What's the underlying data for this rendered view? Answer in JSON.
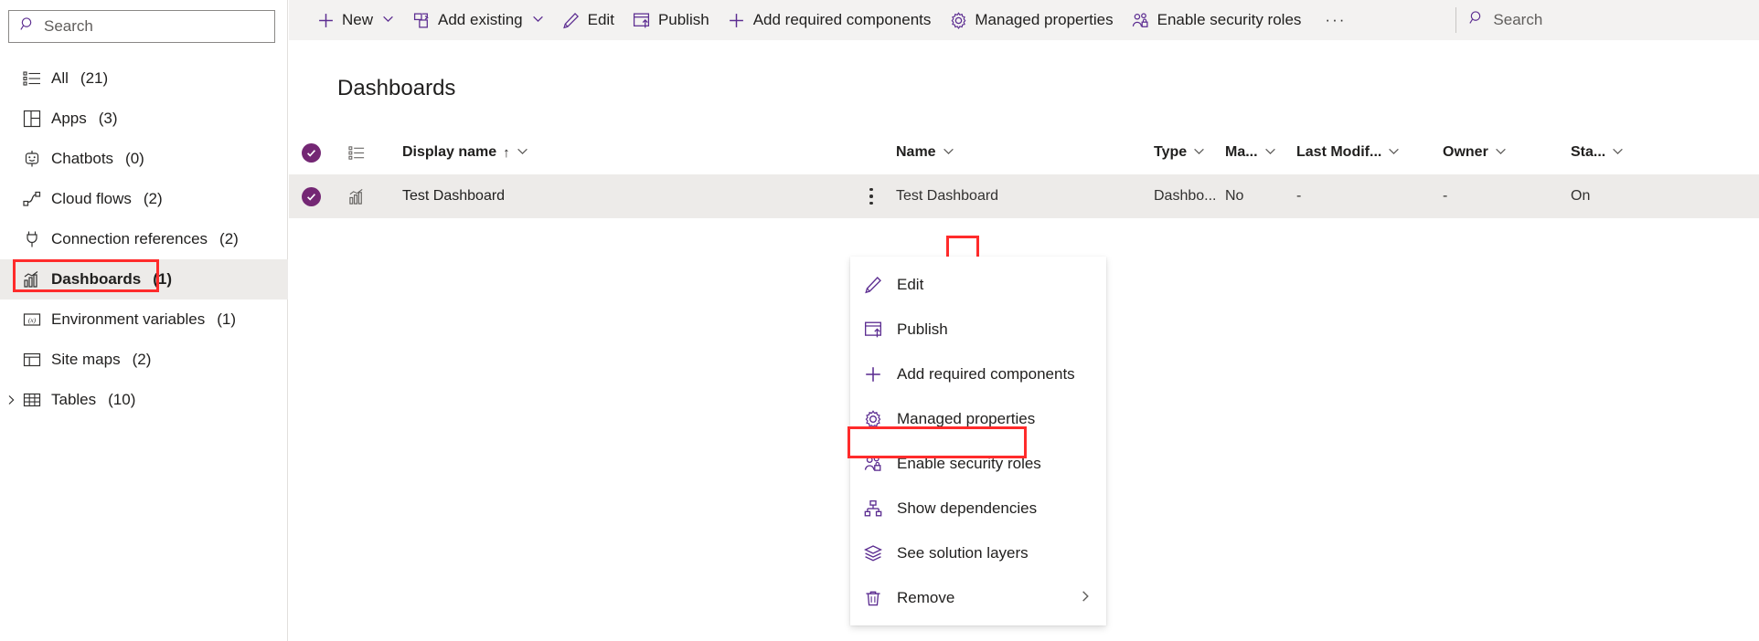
{
  "sidebar": {
    "search": {
      "placeholder": "Search",
      "icon": "search-icon"
    },
    "items": [
      {
        "label": "All",
        "count": "(21)",
        "icon": "list-icon",
        "selected": false,
        "expander": ""
      },
      {
        "label": "Apps",
        "count": "(3)",
        "icon": "apps-grid-icon",
        "selected": false,
        "expander": ""
      },
      {
        "label": "Chatbots",
        "count": "(0)",
        "icon": "chatbot-icon",
        "selected": false,
        "expander": ""
      },
      {
        "label": "Cloud flows",
        "count": "(2)",
        "icon": "cloud-flow-icon",
        "selected": false,
        "expander": ""
      },
      {
        "label": "Connection references",
        "count": "(2)",
        "icon": "connection-plug-icon",
        "selected": false,
        "expander": ""
      },
      {
        "label": "Dashboards",
        "count": "(1)",
        "icon": "dashboard-chart-icon",
        "selected": true,
        "expander": ""
      },
      {
        "label": "Environment variables",
        "count": "(1)",
        "icon": "variable-icon",
        "selected": false,
        "expander": ""
      },
      {
        "label": "Site maps",
        "count": "(2)",
        "icon": "sitemap-layout-icon",
        "selected": false,
        "expander": ""
      },
      {
        "label": "Tables",
        "count": "(10)",
        "icon": "table-grid-icon",
        "selected": false,
        "expander": "chevron-right-icon"
      }
    ]
  },
  "toolbar": {
    "items": [
      {
        "label": "New",
        "icon": "plus-icon",
        "caret": true
      },
      {
        "label": "Add existing",
        "icon": "add-existing-icon",
        "caret": true
      },
      {
        "label": "Edit",
        "icon": "pencil-icon",
        "caret": false
      },
      {
        "label": "Publish",
        "icon": "publish-icon",
        "caret": false
      },
      {
        "label": "Add required components",
        "icon": "plus-icon",
        "caret": false
      },
      {
        "label": "Managed properties",
        "icon": "gear-icon",
        "caret": false
      },
      {
        "label": "Enable security roles",
        "icon": "security-roles-icon",
        "caret": false
      },
      {
        "label": "···",
        "icon": "overflow-icon",
        "caret": false
      }
    ],
    "search": {
      "placeholder": "Search",
      "icon": "search-icon"
    }
  },
  "main": {
    "title": "Dashboards",
    "columns": {
      "display_name": "Display name",
      "name": "Name",
      "type": "Type",
      "managed": "Ma...",
      "last_modified": "Last Modif...",
      "owner": "Owner",
      "status": "Sta..."
    },
    "sort_indicator": "↑",
    "rows": [
      {
        "selected": true,
        "row_icon": "dashboard-chart-icon",
        "display_name": "Test Dashboard",
        "name": "Test Dashboard",
        "type": "Dashbo...",
        "managed": "No",
        "last_modified": "-",
        "owner": "-",
        "status": "On"
      }
    ]
  },
  "context_menu": {
    "items": [
      {
        "label": "Edit",
        "icon": "pencil-icon",
        "submenu": false,
        "highlighted": false
      },
      {
        "label": "Publish",
        "icon": "publish-icon",
        "submenu": false,
        "highlighted": false
      },
      {
        "label": "Add required components",
        "icon": "plus-icon",
        "submenu": false,
        "highlighted": false
      },
      {
        "label": "Managed properties",
        "icon": "gear-icon",
        "submenu": false,
        "highlighted": false
      },
      {
        "label": "Enable security roles",
        "icon": "security-roles-icon",
        "submenu": false,
        "highlighted": true
      },
      {
        "label": "Show dependencies",
        "icon": "dependencies-icon",
        "submenu": false,
        "highlighted": false
      },
      {
        "label": "See solution layers",
        "icon": "layers-icon",
        "submenu": false,
        "highlighted": false
      },
      {
        "label": "Remove",
        "icon": "trash-icon",
        "submenu": true,
        "highlighted": false
      }
    ]
  },
  "colors": {
    "accent_purple": "#5c2d91",
    "selection_purple": "#742774",
    "highlight_red": "#ff2b2b",
    "toolbar_bg": "#f3f2f1",
    "row_selected_bg": "#edebe9",
    "text": "#201f1e"
  }
}
